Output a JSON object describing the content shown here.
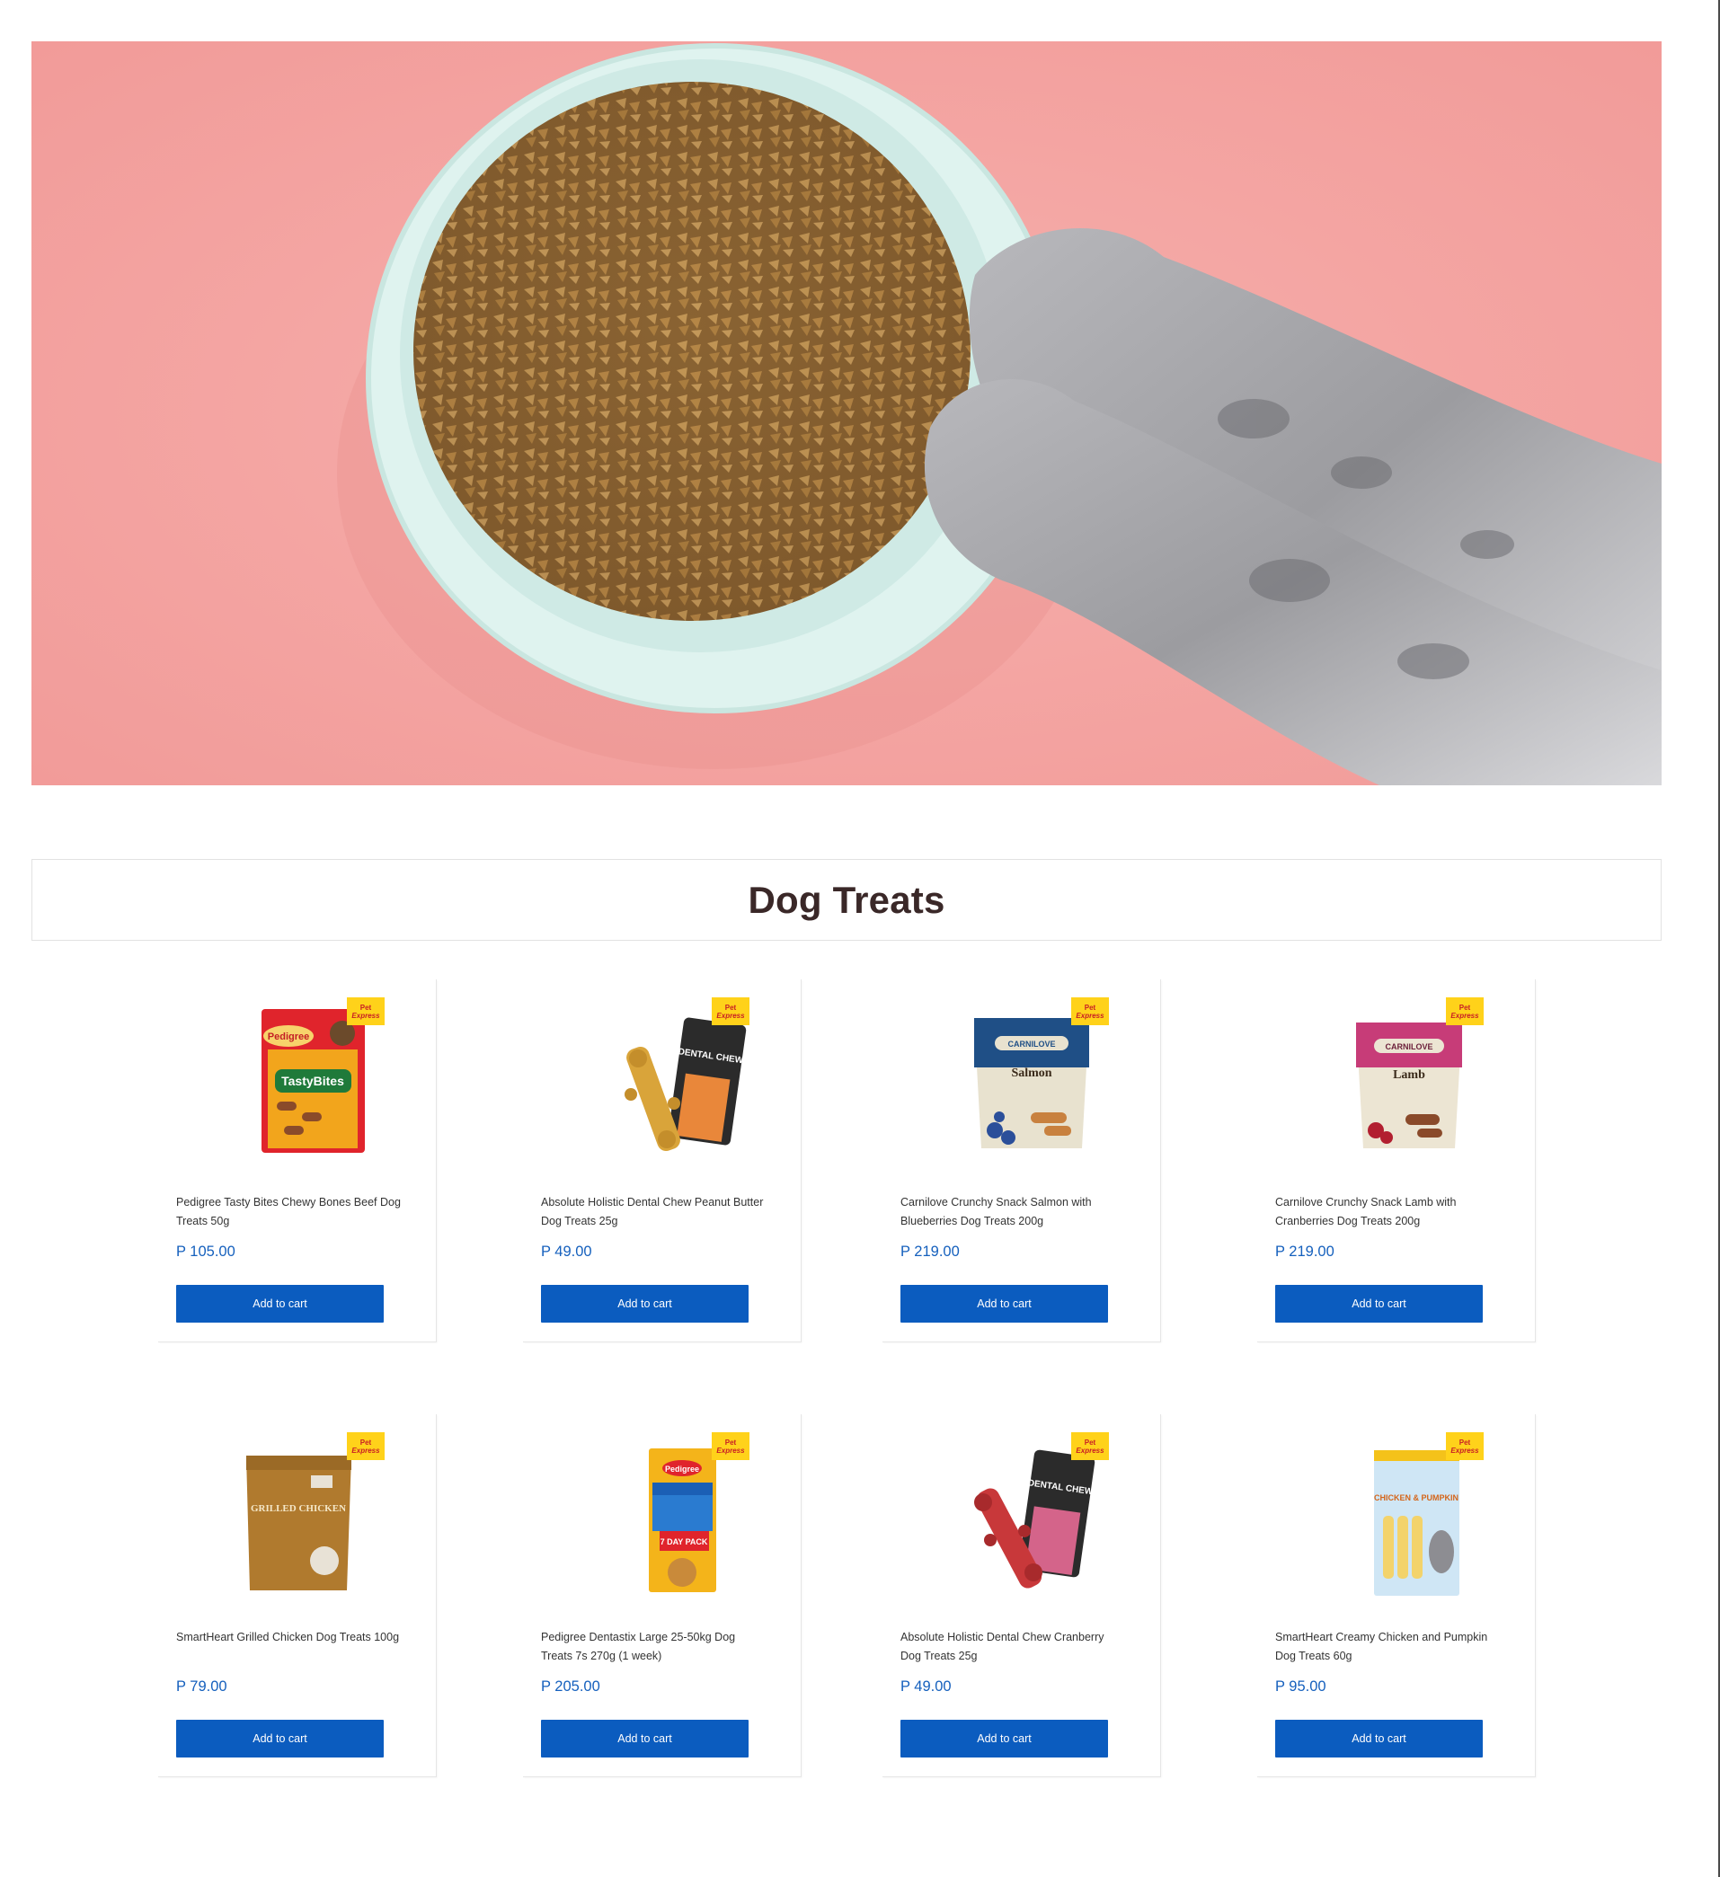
{
  "hero": {
    "alt": "Cat paws reaching into a bowl of dry food"
  },
  "section": {
    "title": "Dog Treats"
  },
  "colors": {
    "accent": "#0b5cbf",
    "price": "#1560bd",
    "badge": "#ffd21a",
    "banner": "#f4a3a1"
  },
  "badge": {
    "line1": "Pet",
    "line2": "Express"
  },
  "products": [
    {
      "name": "Pedigree Tasty Bites Chewy Bones Beef Dog Treats 50g",
      "price": "P 105.00",
      "button": "Add to cart",
      "pack_text": "TastyBites",
      "brand": "Pedigree"
    },
    {
      "name": "Absolute Holistic Dental Chew Peanut Butter Dog Treats 25g",
      "price": "P 49.00",
      "button": "Add to cart",
      "pack_text": "DENTAL CHEW",
      "brand": ""
    },
    {
      "name": "Carnilove Crunchy Snack Salmon with Blueberries Dog Treats 200g",
      "price": "P 219.00",
      "button": "Add to cart",
      "pack_text": "Salmon",
      "brand": "CARNILOVE"
    },
    {
      "name": "Carnilove Crunchy Snack Lamb with Cranberries Dog Treats 200g",
      "price": "P 219.00",
      "button": "Add to cart",
      "pack_text": "Lamb",
      "brand": "CARNILOVE"
    },
    {
      "name": "SmartHeart Grilled Chicken Dog Treats 100g",
      "price": "P 79.00",
      "button": "Add to cart",
      "pack_text": "GRILLED CHICKEN",
      "brand": ""
    },
    {
      "name": "Pedigree Dentastix Large 25-50kg Dog Treats 7s 270g (1 week)",
      "price": "P 205.00",
      "button": "Add to cart",
      "pack_text": "7 DAY PACK",
      "brand": "Pedigree"
    },
    {
      "name": "Absolute Holistic Dental Chew Cranberry Dog Treats 25g",
      "price": "P 49.00",
      "button": "Add to cart",
      "pack_text": "DENTAL CHEW",
      "brand": ""
    },
    {
      "name": "SmartHeart Creamy Chicken and Pumpkin Dog Treats 60g",
      "price": "P 95.00",
      "button": "Add to cart",
      "pack_text": "CHICKEN & PUMPKIN",
      "brand": ""
    }
  ]
}
